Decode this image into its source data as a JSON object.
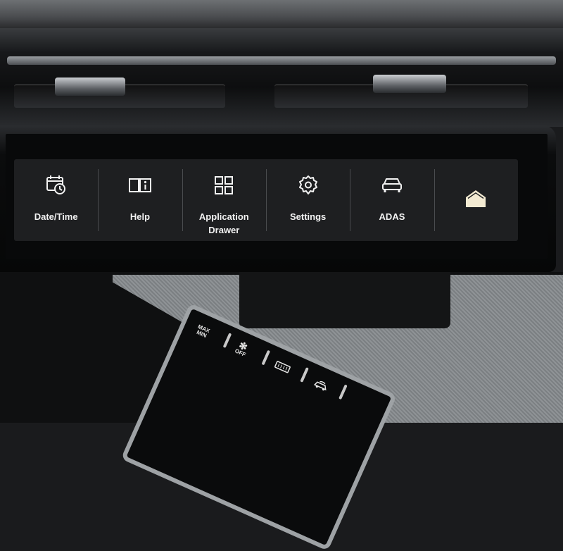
{
  "screen": {
    "tiles": [
      {
        "id": "date-time",
        "label": "Date/Time",
        "icon": "calendar-clock-icon"
      },
      {
        "id": "help",
        "label": "Help",
        "icon": "manual-info-icon"
      },
      {
        "id": "application-drawer",
        "label": "Application Drawer",
        "icon": "app-grid-icon"
      },
      {
        "id": "settings",
        "label": "Settings",
        "icon": "gear-icon"
      },
      {
        "id": "adas",
        "label": "ADAS",
        "icon": "car-icon"
      },
      {
        "id": "home",
        "label": "",
        "icon": "home-icon"
      }
    ]
  },
  "climate_panel": {
    "max_label_top": "MAX",
    "max_label_bottom": "MIN",
    "fan_off_label": "OFF",
    "buttons": [
      "max-min-button",
      "fan-off-button",
      "rear-defrost-button",
      "recirculation-button"
    ]
  },
  "colors": {
    "tile_bg": "#1e1f21",
    "home_icon": "#f3ead2",
    "text": "#f2f2f2"
  }
}
